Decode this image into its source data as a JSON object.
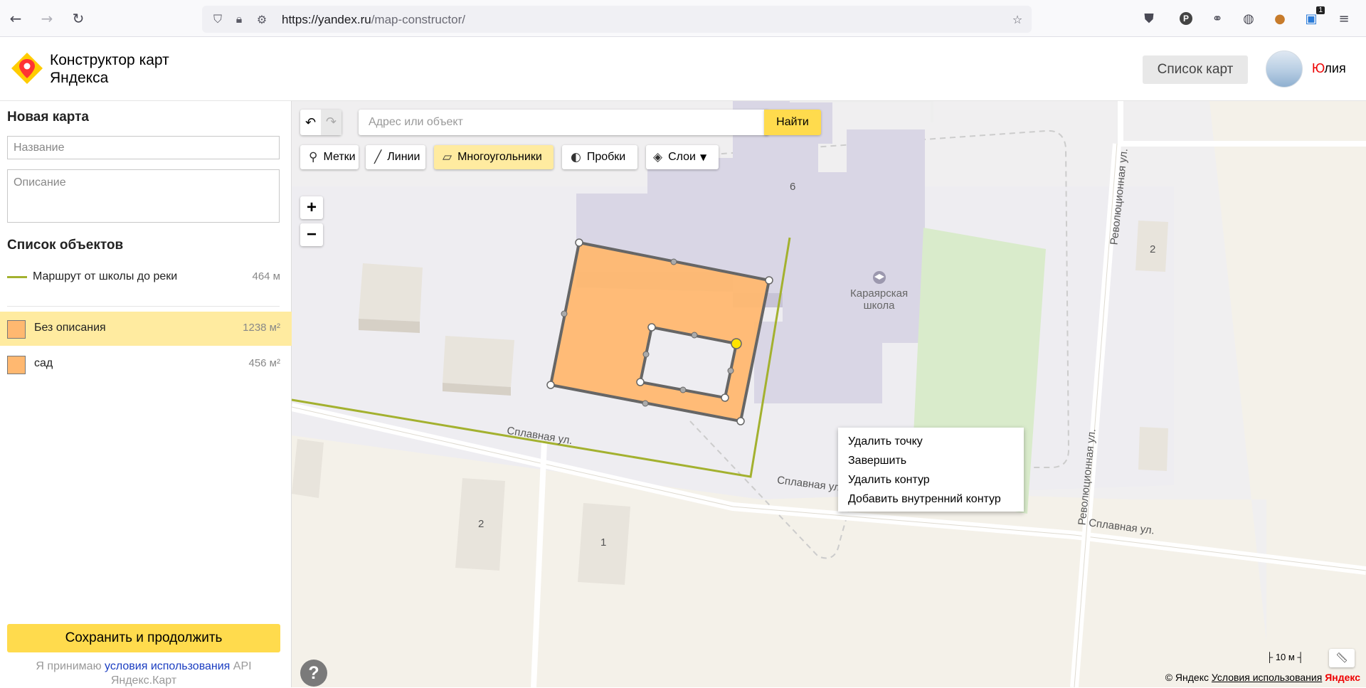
{
  "browser": {
    "url_host": "https://yandex.ru",
    "url_path": "/map-constructor/",
    "back_icon": "←",
    "forward_icon": "→",
    "reload_icon": "↻",
    "star_icon": "☆",
    "menu_icon": "≡",
    "ext_badge": "1"
  },
  "header": {
    "title_line1": "Конструктор карт",
    "title_line2": "Яндекса",
    "maps_list_label": "Список карт",
    "user_name_first": "Ю",
    "user_name_rest": "лия"
  },
  "sidebar": {
    "new_map_title": "Новая карта",
    "name_placeholder": "Название",
    "description_placeholder": "Описание",
    "objects_title": "Список объектов",
    "objects": [
      {
        "label": "Маршрут от школы до реки",
        "value": "464 м",
        "type": "line"
      },
      {
        "label": "Без описания",
        "value": "1238 м²",
        "type": "polygon",
        "active": true
      },
      {
        "label": "сад",
        "value": "456 м²",
        "type": "polygon"
      }
    ],
    "save_label": "Сохранить и продолжить",
    "terms_prefix": "Я принимаю ",
    "terms_link": "условия использования",
    "terms_suffix": " API Яндекс.Карт"
  },
  "toolbar": {
    "search_placeholder": "Адрес или объект",
    "search_button": "Найти",
    "undo_icon": "↶",
    "redo_icon": "↷",
    "tools": [
      {
        "label": "Метки",
        "icon": "placemark-icon",
        "glyph": "⚲"
      },
      {
        "label": "Линии",
        "icon": "line-icon",
        "glyph": "╱"
      },
      {
        "label": "Многоугольники",
        "icon": "polygon-icon",
        "glyph": "▱",
        "active": true
      },
      {
        "label": "Пробки",
        "icon": "traffic-icon",
        "glyph": "◐"
      },
      {
        "label": "Слои",
        "icon": "layers-icon",
        "glyph": "◈"
      }
    ],
    "zoom_in": "+",
    "zoom_out": "−"
  },
  "context_menu": {
    "items": [
      "Удалить точку",
      "Завершить",
      "Удалить контур",
      "Добавить внутренний контур"
    ]
  },
  "map": {
    "school_number": "6",
    "school_name_1": "Караярская",
    "school_name_2": "школа",
    "street_1": "Сплавная ул.",
    "street_2": "Сплавная ул.",
    "street_3": "Сплавная ул.",
    "street_rev_1": "Революционная ул.",
    "street_rev_2": "Революционная ул.",
    "house_2a": "2",
    "house_2b": "2",
    "house_1": "1",
    "scale_label": "10 м",
    "help": "?",
    "copyright_prefix": "© Яндекс",
    "copyright_terms": "Условия использования",
    "copyright_brand": "Яндекс"
  }
}
